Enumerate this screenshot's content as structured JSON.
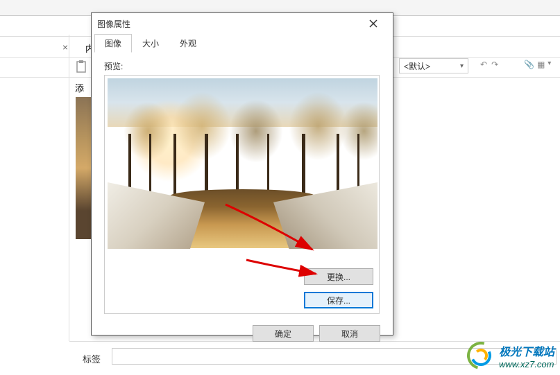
{
  "background": {
    "content_tab": "内容",
    "close_x": "×",
    "format_dropdown": "<默认>",
    "add_text": "添",
    "tags_label": "标签"
  },
  "dialog": {
    "title": "图像属性",
    "tabs": {
      "image": "图像",
      "size": "大小",
      "appearance": "外观"
    },
    "preview_label": "预览:",
    "buttons": {
      "replace": "更换...",
      "save": "保存...",
      "ok": "确定",
      "cancel": "取消"
    }
  },
  "watermark": {
    "title": "极光下载站",
    "url": "www.xz7.com"
  }
}
